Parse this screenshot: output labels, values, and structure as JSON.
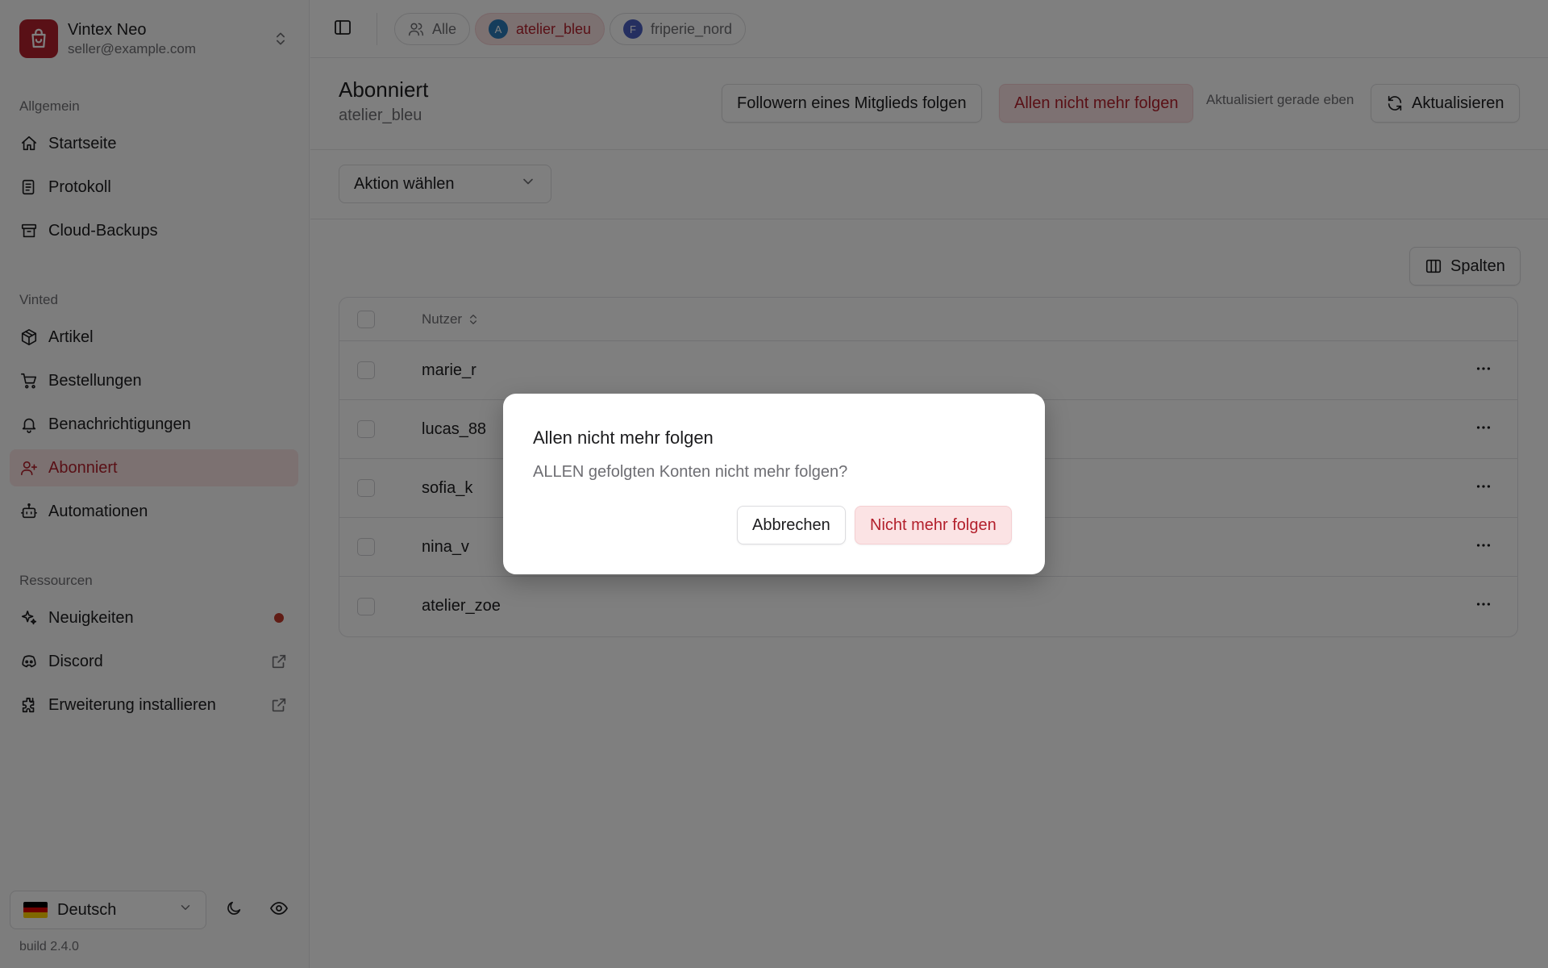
{
  "account": {
    "name": "Vintex Neo",
    "email": "seller@example.com"
  },
  "sidebar": {
    "sections": [
      {
        "label": "Allgemein"
      },
      {
        "label": "Vinted"
      },
      {
        "label": "Ressourcen"
      }
    ],
    "items": [
      {
        "label": "Startseite",
        "icon": "home-icon"
      },
      {
        "label": "Protokoll",
        "icon": "log-icon"
      },
      {
        "label": "Cloud-Backups",
        "icon": "archive-icon"
      },
      {
        "label": "Artikel",
        "icon": "package-icon"
      },
      {
        "label": "Bestellungen",
        "icon": "cart-icon"
      },
      {
        "label": "Benachrichtigungen",
        "icon": "bell-icon"
      },
      {
        "label": "Abonniert",
        "icon": "user-plus-icon",
        "active": true
      },
      {
        "label": "Automationen",
        "icon": "bot-icon"
      },
      {
        "label": "Neuigkeiten",
        "icon": "sparkles-icon",
        "badge": "new-dot"
      },
      {
        "label": "Discord",
        "icon": "discord-icon",
        "trailing": "external-link-icon"
      },
      {
        "label": "Erweiterung installieren",
        "icon": "puzzle-icon",
        "trailing": "external-link-icon"
      }
    ],
    "language": "Deutsch",
    "build": "build 2.4.0"
  },
  "topbar": {
    "chips": [
      {
        "label": "Alle",
        "icon": "users-icon"
      },
      {
        "label": "atelier_bleu",
        "avatar": "A",
        "active": true
      },
      {
        "label": "friperie_nord",
        "avatar": "F"
      }
    ]
  },
  "header": {
    "title": "Abonniert",
    "subtitle": "atelier_bleu",
    "follow_button": "Followern eines Mitglieds folgen",
    "unfollow_all_button": "Allen nicht mehr folgen",
    "updated_text": "Aktualisiert gerade eben",
    "refresh_button": "Aktualisieren"
  },
  "actions": {
    "select_placeholder": "Aktion wählen"
  },
  "table": {
    "columns_button": "Spalten",
    "column_header": "Nutzer",
    "rows": [
      "marie_r",
      "lucas_88",
      "sofia_k",
      "nina_v",
      "atelier_zoe"
    ]
  },
  "dialog": {
    "title": "Allen nicht mehr folgen",
    "text": "ALLEN gefolgten Konten nicht mehr folgen?",
    "cancel": "Abbrechen",
    "confirm": "Nicht mehr folgen"
  },
  "colors": {
    "accent": "#b3202c",
    "accent_bg": "#f8e2e3",
    "overlay": "#000000",
    "avatar_a": "#2b7bb9",
    "avatar_f": "#4a5fc1"
  }
}
